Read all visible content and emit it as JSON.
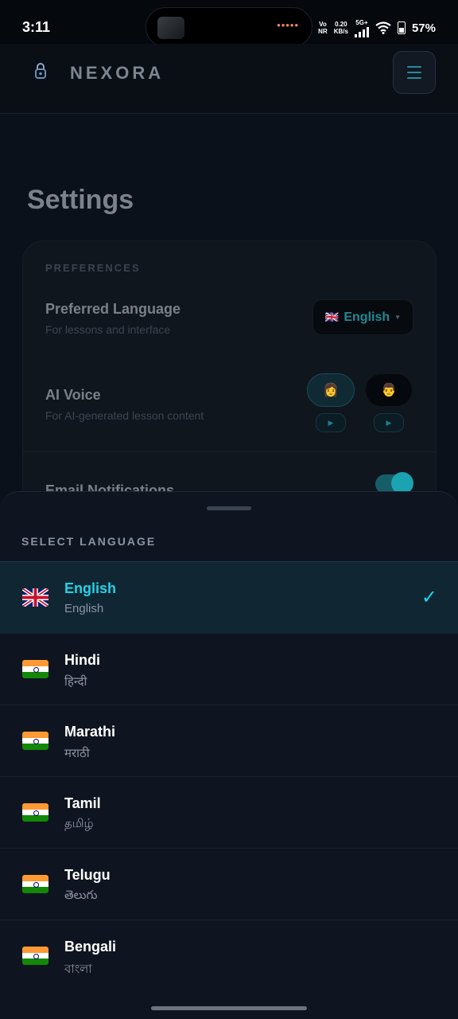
{
  "status_bar": {
    "time": "3:11",
    "network_top": "Vo",
    "network_bottom": "NR",
    "speed_value": "0.20",
    "speed_unit": "KB/s",
    "network_type": "5G+",
    "battery": "57%"
  },
  "header": {
    "brand": "NEXORA",
    "menu_icon": "hamburger-icon",
    "logo_icon": "lock-icon"
  },
  "settings": {
    "title": "Settings",
    "section_label": "PREFERENCES",
    "language_row": {
      "title": "Preferred Language",
      "subtitle": "For lessons and interface",
      "selected_value": "English",
      "flag": "🇬🇧"
    },
    "voice_row": {
      "title": "AI Voice",
      "subtitle": "For AI-generated lesson content",
      "female_avatar": "👩",
      "male_avatar": "👨",
      "play_symbol": "▶"
    },
    "email_row": {
      "title": "Email Notifications",
      "enabled": true
    }
  },
  "language_sheet": {
    "title": "SELECT LANGUAGE",
    "check_symbol": "✓",
    "languages": [
      {
        "name": "English",
        "native": "English",
        "flag": "uk",
        "selected": true
      },
      {
        "name": "Hindi",
        "native": "हिन्दी",
        "flag": "india",
        "selected": false
      },
      {
        "name": "Marathi",
        "native": "मराठी",
        "flag": "india",
        "selected": false
      },
      {
        "name": "Tamil",
        "native": "தமிழ்",
        "flag": "india",
        "selected": false
      },
      {
        "name": "Telugu",
        "native": "తెలుగు",
        "flag": "india",
        "selected": false
      },
      {
        "name": "Bengali",
        "native": "বাংলা",
        "flag": "india",
        "selected": false
      }
    ]
  },
  "colors": {
    "accent": "#22d3e6",
    "background": "#0b111a",
    "sheet": "#0f1520",
    "selected_row": "#112633"
  }
}
